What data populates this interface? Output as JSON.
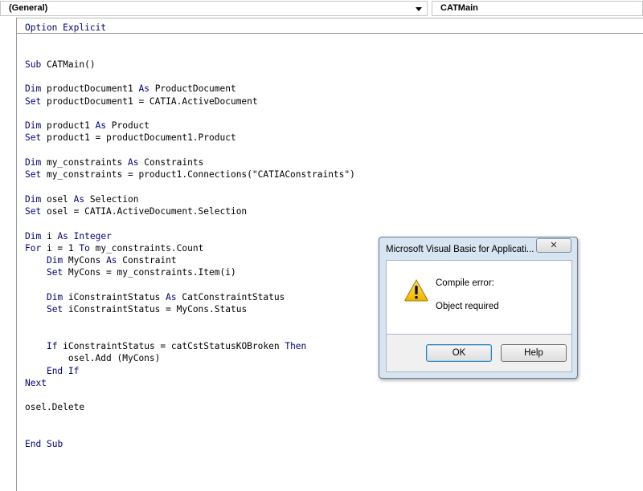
{
  "toolbar": {
    "object_combo": "(General)",
    "procedure_combo": "CATMain"
  },
  "code": {
    "lines": [
      {
        "text": "Option Explicit",
        "kw": [
          "Option",
          "Explicit"
        ]
      },
      {
        "text": "",
        "kw": []
      },
      {
        "text": "",
        "kw": []
      },
      {
        "text": "Sub CATMain()",
        "kw": [
          "Sub"
        ]
      },
      {
        "text": "",
        "kw": []
      },
      {
        "text": "Dim productDocument1 As ProductDocument",
        "kw": [
          "Dim",
          "As"
        ]
      },
      {
        "text": "Set productDocument1 = CATIA.ActiveDocument",
        "kw": [
          "Set"
        ]
      },
      {
        "text": "",
        "kw": []
      },
      {
        "text": "Dim product1 As Product",
        "kw": [
          "Dim",
          "As"
        ]
      },
      {
        "text": "Set product1 = productDocument1.Product",
        "kw": [
          "Set"
        ]
      },
      {
        "text": "",
        "kw": []
      },
      {
        "text": "Dim my_constraints As Constraints",
        "kw": [
          "Dim",
          "As"
        ]
      },
      {
        "text": "Set my_constraints = product1.Connections(\"CATIAConstraints\")",
        "kw": [
          "Set"
        ]
      },
      {
        "text": "",
        "kw": []
      },
      {
        "text": "Dim osel As Selection",
        "kw": [
          "Dim",
          "As"
        ]
      },
      {
        "text": "Set osel = CATIA.ActiveDocument.Selection",
        "kw": [
          "Set"
        ]
      },
      {
        "text": "",
        "kw": []
      },
      {
        "text": "Dim i As Integer",
        "kw": [
          "Dim",
          "As",
          "Integer"
        ]
      },
      {
        "text": "For i = 1 To my_constraints.Count",
        "kw": [
          "For",
          "To"
        ]
      },
      {
        "text": "    Dim MyCons As Constraint",
        "kw": [
          "Dim",
          "As"
        ]
      },
      {
        "text": "    Set MyCons = my_constraints.Item(i)",
        "kw": [
          "Set"
        ]
      },
      {
        "text": "",
        "kw": []
      },
      {
        "text": "    Dim iConstraintStatus As CatConstraintStatus",
        "kw": [
          "Dim",
          "As"
        ]
      },
      {
        "text": "    Set iConstraintStatus = MyCons.Status",
        "kw": [
          "Set"
        ]
      },
      {
        "text": "",
        "kw": []
      },
      {
        "text": "",
        "kw": []
      },
      {
        "text": "    If iConstraintStatus = catCstStatusKOBroken Then",
        "kw": [
          "If",
          "Then"
        ]
      },
      {
        "text": "        osel.Add (MyCons)",
        "kw": []
      },
      {
        "text": "    End If",
        "kw": [
          "End",
          "If"
        ]
      },
      {
        "text": "Next",
        "kw": [
          "Next"
        ]
      },
      {
        "text": "",
        "kw": []
      },
      {
        "text": "osel.Delete",
        "kw": []
      },
      {
        "text": "",
        "kw": []
      },
      {
        "text": "",
        "kw": []
      },
      {
        "text": "End Sub",
        "kw": [
          "End",
          "Sub"
        ]
      }
    ]
  },
  "dialog": {
    "title": "Microsoft Visual Basic for Applicati...",
    "close_label": "✕",
    "message_title": "Compile error:",
    "message_body": "Object required",
    "ok_label": "OK",
    "help_label": "Help"
  },
  "colors": {
    "keyword": "#00008b",
    "dialog_frame": "#d7e4f2",
    "warning_fill": "#f5c400"
  }
}
